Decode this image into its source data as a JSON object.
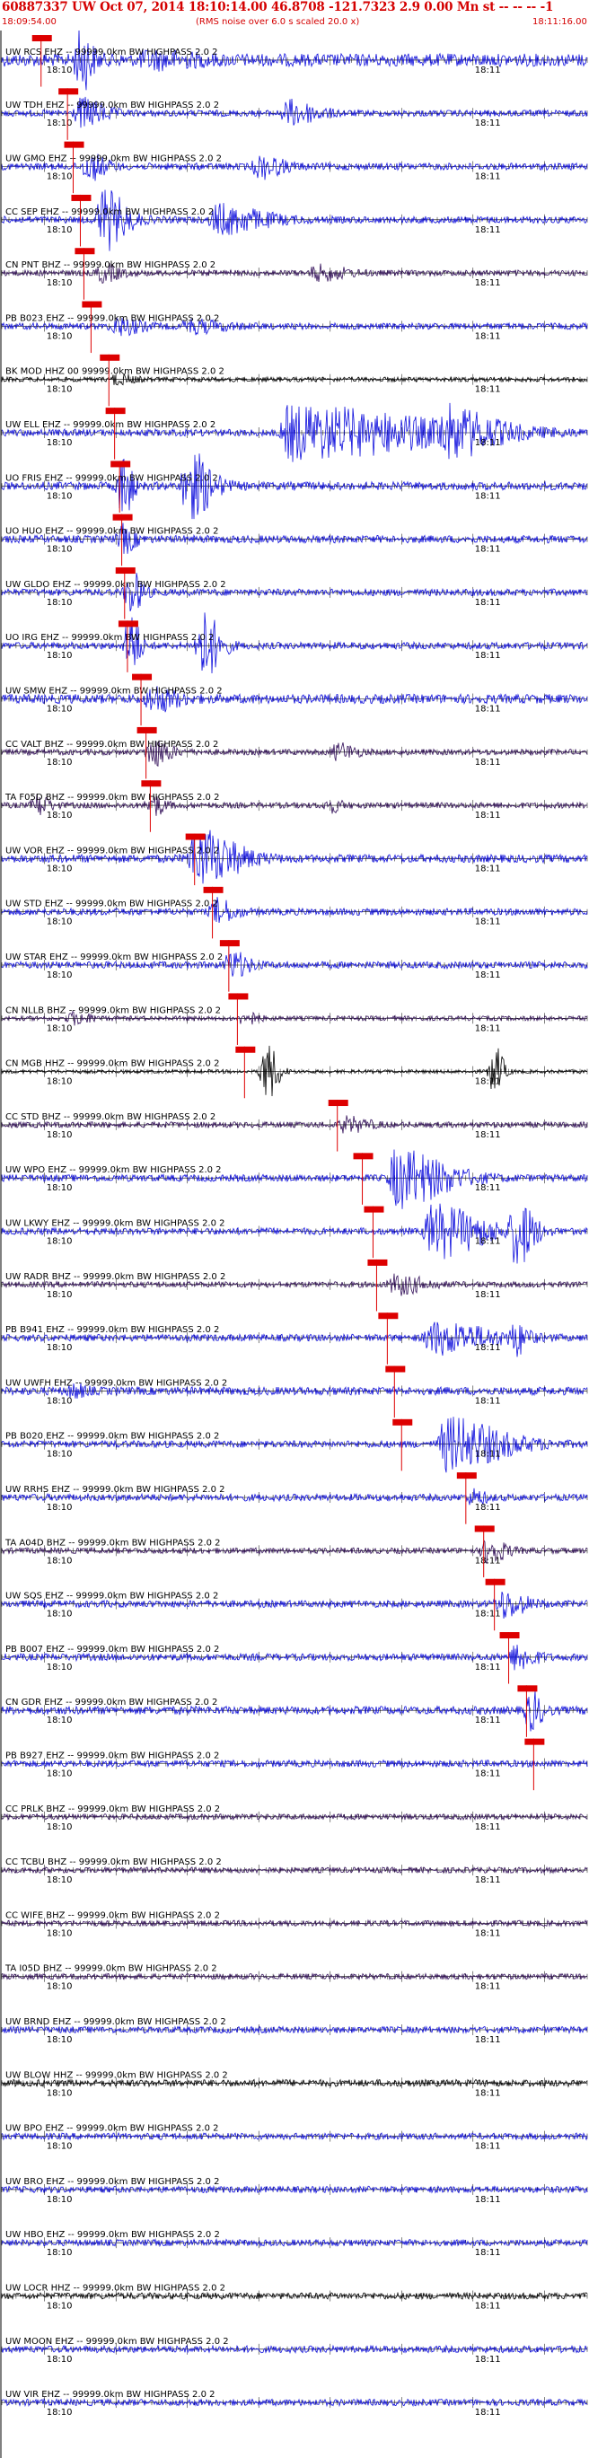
{
  "header": {
    "title": "60887337 UW Oct 07, 2014 18:10:14.00   46.8708 -121.7323  2.9 0.00 Mn st -- -- --  -1",
    "start_time": "18:09:54.00",
    "rms_note": "(RMS noise over 6.0 s scaled 20.0 x)",
    "end_time": "18:11:16.00"
  },
  "chart_data": {
    "type": "line",
    "title": "60887337 UW Oct 07, 2014 18:10:14.00   46.8708 -121.7323  2.9 0.00 Mn st -- -- --  -1",
    "x_start_label": "18:09:54.00",
    "x_end_label": "18:11:16.00",
    "xlim_seconds": [
      0,
      82
    ],
    "minute_tick_labels": [
      "18:10",
      "18:11"
    ],
    "minute_ticks_seconds": [
      6,
      66
    ],
    "grid": "vertical second ticks on every trace",
    "colors": {
      "blue": "#1010dd",
      "purple": "#33105a",
      "black": "#000000",
      "pick": "#dd0000",
      "text": "#d40000"
    },
    "traces": [
      {
        "label": "UW RCS EHZ -- 99999.0km BW  HIGHPASS  2.0  2",
        "color": "#1010dd",
        "amp": 0.55,
        "bursts": [
          [
            11,
            2,
            2.5
          ],
          [
            20,
            8,
            0.5
          ]
        ],
        "pick": 5.5
      },
      {
        "label": "UW TDH EHZ -- 99999.0km BW  HIGHPASS  2.0  2",
        "color": "#1010dd",
        "amp": 0.28,
        "bursts": [
          [
            11,
            4,
            1.2
          ],
          [
            40,
            5,
            1.0
          ]
        ],
        "pick": 9.2
      },
      {
        "label": "UW GMO EHZ -- 99999.0km BW  HIGHPASS  2.0  2",
        "color": "#1010dd",
        "amp": 0.3,
        "bursts": [
          [
            12,
            3,
            1.1
          ],
          [
            36,
            4,
            0.9
          ]
        ],
        "pick": 10
      },
      {
        "label": "CC SEP EHZ -- 99999.0km BW  HIGHPASS  2.0  2",
        "color": "#1010dd",
        "amp": 0.3,
        "bursts": [
          [
            14,
            4,
            2.6
          ],
          [
            30,
            8,
            1.2
          ]
        ],
        "pick": 11
      },
      {
        "label": "CN PNT BHZ -- 99999.0km BW  HIGHPASS  2.0  2",
        "color": "#33105a",
        "amp": 0.25,
        "bursts": [
          [
            14,
            3,
            0.7
          ],
          [
            44,
            5,
            0.6
          ]
        ],
        "pick": 11.5
      },
      {
        "label": "PB B023 EHZ -- 99999.0km BW  HIGHPASS  2.0  2",
        "color": "#1010dd",
        "amp": 0.28,
        "bursts": [
          [
            16,
            4,
            0.7
          ],
          [
            26,
            6,
            0.5
          ]
        ],
        "pick": 12.5
      },
      {
        "label": "BK MOD HHZ 00 99999.0km BW  HIGHPASS  2.0  2",
        "color": "#000000",
        "amp": 0.2,
        "bursts": [
          [
            16,
            3,
            0.4
          ]
        ],
        "pick": 15
      },
      {
        "label": "UW ELL EHZ -- 99999.0km BW  HIGHPASS  2.0  2",
        "color": "#1010dd",
        "amp": 0.3,
        "bursts": [
          [
            40,
            25,
            2.2
          ],
          [
            62,
            8,
            1.5
          ]
        ],
        "pick": 15.8
      },
      {
        "label": "UO FRIS EHZ -- 99999.0km BW  HIGHPASS  2.0  2",
        "color": "#1010dd",
        "amp": 0.35,
        "bursts": [
          [
            17,
            1.5,
            3
          ],
          [
            26,
            4,
            3
          ]
        ],
        "pick": 16.5
      },
      {
        "label": "UO HUO EHZ -- 99999.0km BW  HIGHPASS  2.0  2",
        "color": "#1010dd",
        "amp": 0.33,
        "bursts": [
          [
            17,
            2,
            1.1
          ]
        ],
        "pick": 16.8
      },
      {
        "label": "UW GLDO EHZ -- 99999.0km BW  HIGHPASS  2.0  2",
        "color": "#1010dd",
        "amp": 0.3,
        "bursts": [
          [
            18,
            2,
            1.8
          ]
        ],
        "pick": 17.2
      },
      {
        "label": "UO IRG EHZ -- 99999.0km BW  HIGHPASS  2.0  2",
        "color": "#1010dd",
        "amp": 0.3,
        "bursts": [
          [
            18,
            1.5,
            3
          ],
          [
            28,
            3,
            3
          ]
        ],
        "pick": 17.6
      },
      {
        "label": "UW SMW EHZ -- 99999.0km BW  HIGHPASS  2.0  2",
        "color": "#1010dd",
        "amp": 0.4,
        "bursts": [
          [
            21,
            4,
            1.0
          ]
        ],
        "pick": 19.5
      },
      {
        "label": "CC VALT BHZ -- 99999.0km BW  HIGHPASS  2.0  2",
        "color": "#33105a",
        "amp": 0.25,
        "bursts": [
          [
            21,
            3,
            1.2
          ],
          [
            47,
            3,
            0.7
          ]
        ],
        "pick": 20.2
      },
      {
        "label": "TA F05D BHZ -- 99999.0km BW  HIGHPASS  2.0  2",
        "color": "#33105a",
        "amp": 0.25,
        "bursts": [
          [
            5,
            2,
            0.9
          ],
          [
            21,
            2,
            0.9
          ],
          [
            46,
            2,
            0.5
          ]
        ],
        "pick": 20.8
      },
      {
        "label": "UW VOR EHZ -- 99999.0km BW  HIGHPASS  2.0  2",
        "color": "#1010dd",
        "amp": 0.35,
        "bursts": [
          [
            27,
            7,
            2.4
          ]
        ],
        "pick": 27
      },
      {
        "label": "UW STD EHZ -- 99999.0km BW  HIGHPASS  2.0  2",
        "color": "#1010dd",
        "amp": 0.3,
        "bursts": [
          [
            30,
            3,
            1.0
          ]
        ],
        "pick": 29.5
      },
      {
        "label": "UW STAR EHZ -- 99999.0km BW  HIGHPASS  2.0  2",
        "color": "#1010dd",
        "amp": 0.3,
        "bursts": [
          [
            32,
            3,
            1.1
          ]
        ],
        "pick": 31.8
      },
      {
        "label": "CN NLLB BHZ -- 99999.0km BW  HIGHPASS  2.0  2",
        "color": "#33105a",
        "amp": 0.2,
        "bursts": [
          [
            10,
            3,
            0.5
          ],
          [
            34,
            2,
            0.6
          ]
        ],
        "pick": 33
      },
      {
        "label": "CN MGB HHZ -- 99999.0km BW  HIGHPASS  2.0  2",
        "color": "#000000",
        "amp": 0.15,
        "bursts": [
          [
            37,
            2,
            2.6
          ],
          [
            69,
            1.5,
            2.2
          ]
        ],
        "pick": 34
      },
      {
        "label": "CC STD BHZ -- 99999.0km BW  HIGHPASS  2.0  2",
        "color": "#33105a",
        "amp": 0.25,
        "bursts": [
          [
            48,
            4,
            0.6
          ]
        ],
        "pick": 47
      },
      {
        "label": "UW WPO EHZ -- 99999.0km BW  HIGHPASS  2.0  2",
        "color": "#1010dd",
        "amp": 0.3,
        "bursts": [
          [
            55,
            9,
            2.4
          ]
        ],
        "pick": 50.5
      },
      {
        "label": "UW LKWY EHZ -- 99999.0km BW  HIGHPASS  2.0  2",
        "color": "#1010dd",
        "amp": 0.3,
        "bursts": [
          [
            60,
            9,
            2.2
          ],
          [
            72,
            3,
            2.8
          ]
        ],
        "pick": 52
      },
      {
        "label": "UW RADR BHZ -- 99999.0km BW  HIGHPASS  2.0  2",
        "color": "#33105a",
        "amp": 0.25,
        "bursts": [
          [
            55,
            5,
            0.8
          ]
        ],
        "pick": 52.5
      },
      {
        "label": "PB B941 EHZ -- 99999.0km BW  HIGHPASS  2.0  2",
        "color": "#1010dd",
        "amp": 0.3,
        "bursts": [
          [
            60,
            10,
            1.3
          ],
          [
            72,
            2,
            1.2
          ]
        ],
        "pick": 54
      },
      {
        "label": "UW UWFH EHZ -- 99999.0km BW  HIGHPASS  2.0  2",
        "color": "#1010dd",
        "amp": 0.35,
        "bursts": [
          [
            10,
            2,
            0.5
          ]
        ],
        "pick": 55
      },
      {
        "label": "PB B020 EHZ -- 99999.0km BW  HIGHPASS  2.0  2",
        "color": "#1010dd",
        "amp": 0.3,
        "bursts": [
          [
            62,
            10,
            2.2
          ]
        ],
        "pick": 56
      },
      {
        "label": "UW RRHS EHZ -- 99999.0km BW  HIGHPASS  2.0  2",
        "color": "#1010dd",
        "amp": 0.3,
        "bursts": [
          [
            66,
            2,
            0.6
          ]
        ],
        "pick": 65
      },
      {
        "label": "TA A04D BHZ -- 99999.0km BW  HIGHPASS  2.0  2",
        "color": "#33105a",
        "amp": 0.25,
        "bursts": [
          [
            68,
            3,
            1.1
          ]
        ],
        "pick": 67.5
      },
      {
        "label": "UW SQS EHZ -- 99999.0km BW  HIGHPASS  2.0  2",
        "color": "#1010dd",
        "amp": 0.3,
        "bursts": [
          [
            70,
            4,
            1.1
          ]
        ],
        "pick": 69
      },
      {
        "label": "PB B007 EHZ -- 99999.0km BW  HIGHPASS  2.0  2",
        "color": "#1010dd",
        "amp": 0.3,
        "bursts": [
          [
            72,
            3,
            1.1
          ]
        ],
        "pick": 71
      },
      {
        "label": "CN GDR EHZ -- 99999.0km BW  HIGHPASS  2.0  2",
        "color": "#1010dd",
        "amp": 0.35,
        "bursts": [
          [
            74,
            2,
            1.6
          ]
        ],
        "pick": 73.5
      },
      {
        "label": "PB B927 EHZ -- 99999.0km BW  HIGHPASS  2.0  2",
        "color": "#1010dd",
        "amp": 0.3,
        "bursts": [],
        "pick": 74.5
      },
      {
        "label": "CC PRLK BHZ -- 99999.0km BW  HIGHPASS  2.0  2",
        "color": "#33105a",
        "amp": 0.25,
        "bursts": []
      },
      {
        "label": "CC TCBU BHZ -- 99999.0km BW  HIGHPASS  2.0  2",
        "color": "#33105a",
        "amp": 0.25,
        "bursts": []
      },
      {
        "label": "CC WIFE BHZ -- 99999.0km BW  HIGHPASS  2.0  2",
        "color": "#33105a",
        "amp": 0.25,
        "bursts": []
      },
      {
        "label": "TA I05D BHZ -- 99999.0km BW  HIGHPASS  2.0  2",
        "color": "#33105a",
        "amp": 0.25,
        "bursts": []
      },
      {
        "label": "UW BRND EHZ -- 99999.0km BW  HIGHPASS  2.0  2",
        "color": "#1010dd",
        "amp": 0.28,
        "bursts": []
      },
      {
        "label": "UW BLOW HHZ -- 99999.0km BW  HIGHPASS  2.0  2",
        "color": "#000000",
        "amp": 0.3,
        "bursts": []
      },
      {
        "label": "UW BPO EHZ -- 99999.0km BW  HIGHPASS  2.0  2",
        "color": "#1010dd",
        "amp": 0.28,
        "bursts": []
      },
      {
        "label": "UW BRO EHZ -- 99999.0km BW  HIGHPASS  2.0  2",
        "color": "#1010dd",
        "amp": 0.28,
        "bursts": []
      },
      {
        "label": "UW HBO EHZ -- 99999.0km BW  HIGHPASS  2.0  2",
        "color": "#1010dd",
        "amp": 0.28,
        "bursts": []
      },
      {
        "label": "UW LOCR HHZ -- 99999.0km BW  HIGHPASS  2.0  2",
        "color": "#000000",
        "amp": 0.28,
        "bursts": []
      },
      {
        "label": "UW MOON EHZ -- 99999.0km BW  HIGHPASS  2.0  2",
        "color": "#1010dd",
        "amp": 0.3,
        "bursts": []
      },
      {
        "label": "UW VIR EHZ -- 99999.0km BW  HIGHPASS  2.0  2",
        "color": "#1010dd",
        "amp": 0.28,
        "bursts": []
      }
    ]
  }
}
